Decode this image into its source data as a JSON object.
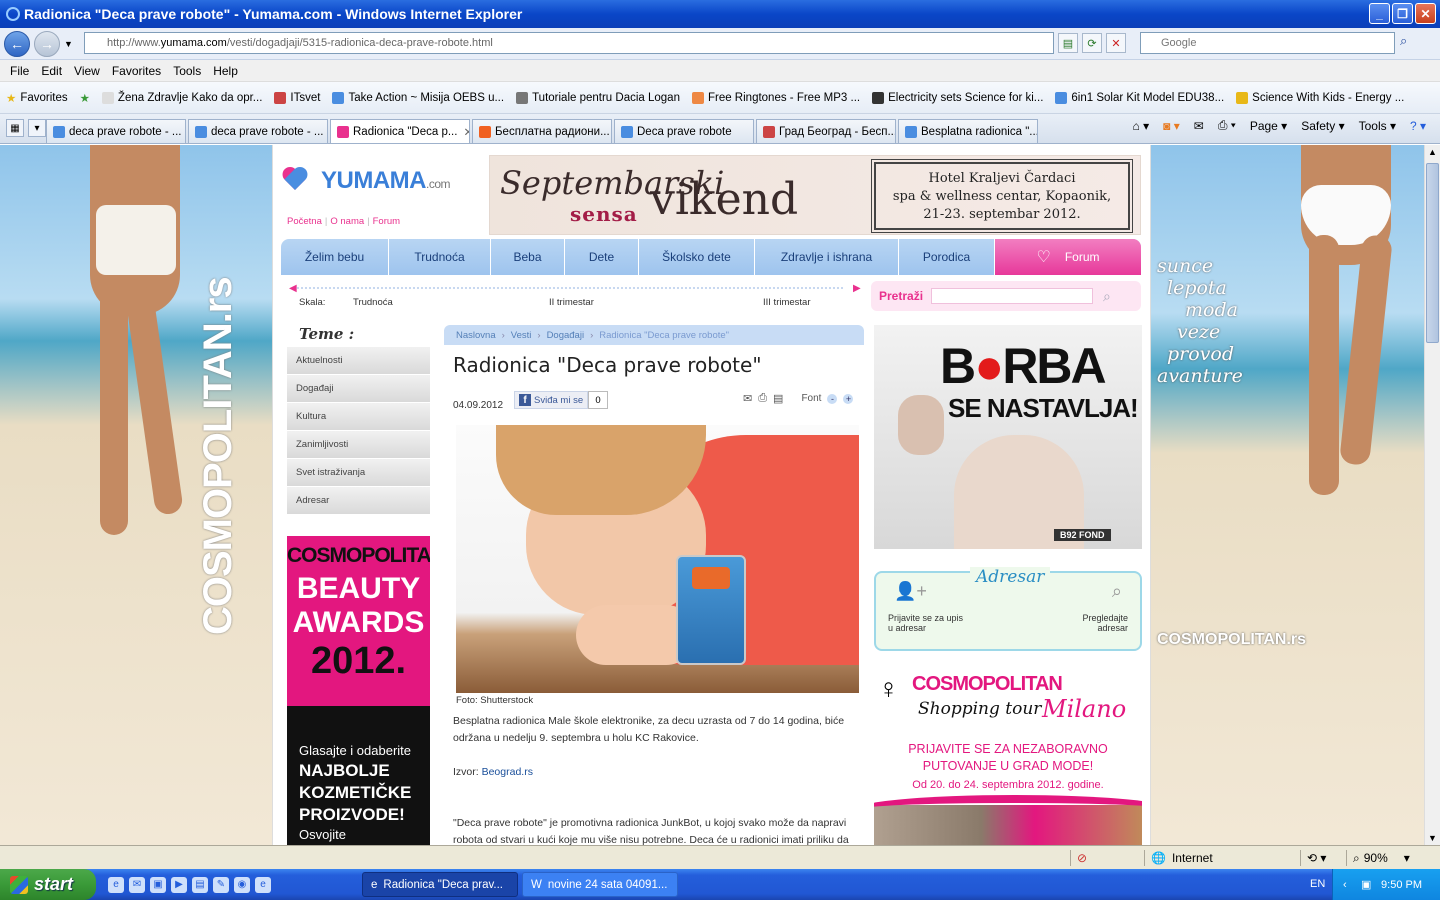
{
  "window": {
    "title": "Radionica \"Deca prave robote\" - Yumama.com - Windows Internet Explorer"
  },
  "address": {
    "url_prefix": "http://www.",
    "url_domain": "yumama.com",
    "url_path": "/vesti/dogadjaji/5315-radionica-deca-prave-robote.html",
    "search_placeholder": "Google"
  },
  "menu": [
    "File",
    "Edit",
    "View",
    "Favorites",
    "Tools",
    "Help"
  ],
  "favorites": {
    "label": "Favorites",
    "items": [
      "Žena Zdravlje Kako da opr...",
      "ITsvet",
      "Take Action ~ Misija OEBS u...",
      "Tutoriale pentru Dacia Logan",
      "Free Ringtones - Free MP3 ...",
      "Electricity sets Science for ki...",
      "6in1 Solar Kit Model EDU38...",
      "Science With Kids - Energy ..."
    ]
  },
  "tabs": [
    "deca prave robote - ...",
    "deca prave robote - ...",
    "Radionica \"Deca p...",
    "Бесплатна радиони...",
    "Deca prave robote",
    "Град Београд - Бесп...",
    "Besplatna radionica \"..."
  ],
  "tabtools": [
    "Page",
    "Safety",
    "Tools"
  ],
  "site": {
    "logo": "YUMAMA",
    "logo_suffix": ".com",
    "toplinks": [
      "Početna",
      "O nama",
      "Forum"
    ],
    "banner": {
      "line1": "Septembarski",
      "line2": "sensa",
      "line3": "vikend",
      "hotel1": "Hotel Kraljevi Čardaci",
      "hotel2": "spa & wellness centar, Kopaonik,",
      "hotel3": "21-23. septembar 2012."
    },
    "nav": [
      "Želim bebu",
      "Trudnoća",
      "Beba",
      "Dete",
      "Školsko dete",
      "Zdravlje i ishrana",
      "Porodica",
      "Forum"
    ],
    "scale": {
      "skala": "Skala:",
      "t1": "Trudnoća",
      "t2": "II trimestar",
      "t3": "III trimestar"
    },
    "search_label": "Pretraži",
    "teme": {
      "heading": "Teme :",
      "items": [
        "Aktuelnosti",
        "Događaji",
        "Kultura",
        "Zanimljivosti",
        "Svet istraživanja",
        "Adresar"
      ]
    },
    "beauty_ad": {
      "brand": "COSMOPOLITAN",
      "l1": "BEAUTY",
      "l2": "AWARDS",
      "year": "2012.",
      "t1": "Glasajte i odaberite",
      "t2": "NAJBOLJE",
      "t3": "KOZMETIČKE",
      "t4": "PROIZVODE!",
      "t5": "Osvojite"
    },
    "breadcrumb": [
      "Naslovna",
      "Vesti",
      "Događaji",
      "Radionica \"Deca prave robote\""
    ],
    "article": {
      "title": "Radionica \"Deca prave robote\"",
      "date": "04.09.2012",
      "like": "Sviđa mi se",
      "like_count": "0",
      "font_label": "Font",
      "caption": "Foto: Shutterstock",
      "p1": "Besplatna radionica Male škole elektronike, za decu uzrasta od 7 do 14 godina, biće održana u nedelju 9. septembra u holu KC Rakovice.",
      "source_label": "Izvor:",
      "source": "Beograd.rs",
      "p2": "\"Deca prave robote\" je promotivna radionica JunkBot, u kojoj svako može da napravi robota od stvari u kući koje mu više nisu potrebne. Deca će u radionici imati priliku da"
    },
    "b92": {
      "w1": "B",
      "w2": "RBA",
      "w3": "SE NASTAVLJA!",
      "fond": "B92 FOND"
    },
    "adresar": {
      "title": "Adresar",
      "left": "Prijavite se za upis u adresar",
      "right": "Pregledajte adresar"
    },
    "milano": {
      "brand": "COSMOPOLITAN",
      "tour": "Shopping tour",
      "city": "Milano",
      "l1": "PRIJAVITE SE ZA NEZABORAVNO",
      "l2": "PUTOVANJE U GRAD MODE!",
      "dates": "Od 20. do 24. septembra 2012. godine."
    },
    "side_left_brand": "COSMOPOLITAN.rs",
    "side_right": {
      "poem": [
        "sunce",
        "lepota",
        "moda",
        "veze",
        "provod",
        "avanture"
      ],
      "brand": "COSMOPOLITAN.rs"
    }
  },
  "status": {
    "zone": "Internet",
    "zoom": "90%"
  },
  "taskbar": {
    "start": "start",
    "task1": "Radionica \"Deca prav...",
    "task2": "novine 24 sata 04091...",
    "lang": "EN",
    "time": "9:50 PM"
  }
}
